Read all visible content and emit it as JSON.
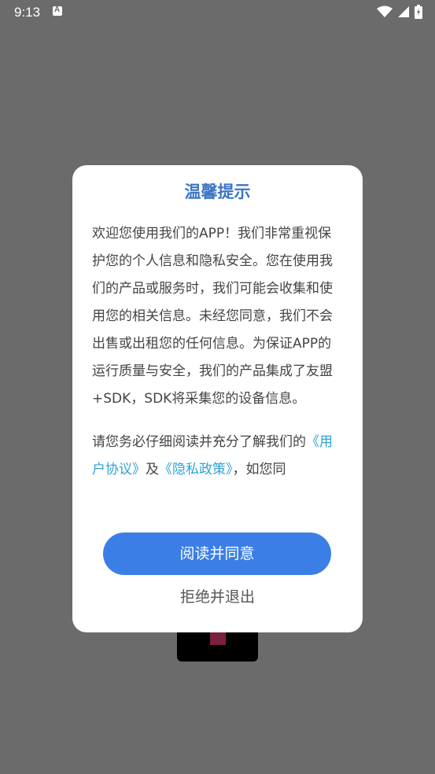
{
  "status_bar": {
    "time": "9:13",
    "notification_icon": "a-notification-icon",
    "wifi_icon": "wifi-icon",
    "signal_icon": "signal-icon",
    "battery_icon": "battery-icon"
  },
  "dialog": {
    "title": "温馨提示",
    "paragraph1": "欢迎您使用我们的APP！我们非常重视保护您的个人信息和隐私安全。您在使用我们的产品或服务时，我们可能会收集和使用您的相关信息。未经您同意，我们不会出售或出租您的任何信息。为保证APP的运行质量与安全，我们的产品集成了友盟+SDK，SDK将采集您的设备信息。",
    "paragraph2_intro": "请您务必仔细阅读并充分了解我们的",
    "user_agreement_link": "《用户协议》",
    "and_text": "及",
    "privacy_policy_link": "《隐私政策》",
    "paragraph2_tail": "，如您同",
    "agree_label": "阅读并同意",
    "refuse_label": "拒绝并退出"
  },
  "colors": {
    "title": "#3a75c4",
    "link": "#2fa2d6",
    "button": "#3b7fe6",
    "overlay": "#6b6b6b"
  }
}
